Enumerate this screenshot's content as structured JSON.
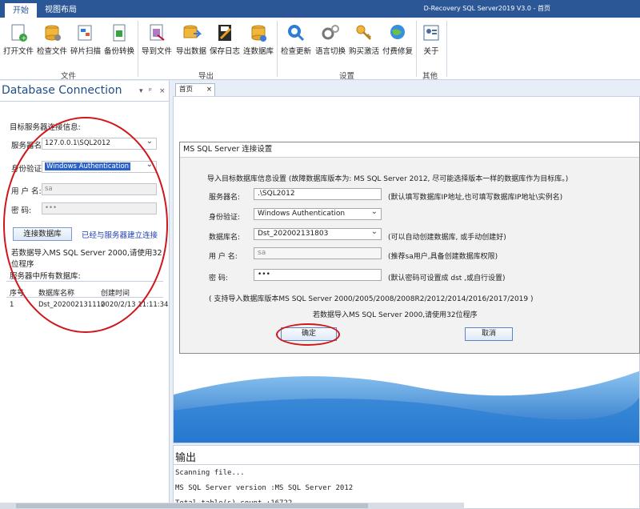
{
  "app": {
    "title": "D-Recovery SQL Server2019 V3.0 - 首页",
    "tabs": [
      "开始",
      "视图布局"
    ]
  },
  "ribbon": {
    "groups": [
      {
        "label": "文件",
        "buttons": [
          "打开文件",
          "检查文件",
          "碎片扫描",
          "备份转换"
        ]
      },
      {
        "label": "导出",
        "buttons": [
          "导到文件",
          "导出数据",
          "保存日志",
          "连数据库"
        ]
      },
      {
        "label": "设置",
        "buttons": [
          "检查更新",
          "语言切换",
          "购买激活",
          "付费修复"
        ]
      },
      {
        "label": "其他",
        "buttons": [
          "关于"
        ]
      }
    ]
  },
  "left_panel": {
    "title": "Database Connection",
    "controls": [
      "▾",
      "ᵖ",
      "×"
    ],
    "section_title": "目标服务器连接信息:",
    "server_label": "服务器名:",
    "server_value": "127.0.0.1\\SQL2012",
    "auth_label": "身份验证:",
    "auth_value": "Windows Authentication",
    "user_label": "用 户 名:",
    "user_value": "sa",
    "pwd_label": "密   码:",
    "pwd_value": "•••",
    "connect_button": "连接数据库",
    "connected_status": "已经与服务器建立连接",
    "note": "若数据导入MS SQL Server 2000,请使用32位程序",
    "db_section": "服务器中所有数据库:",
    "table": {
      "headers": [
        "序号",
        "数据库名称",
        "创建时间"
      ],
      "rows": [
        [
          "1",
          "Dst_202002131110",
          "2020/2/13 11:11:34"
        ]
      ]
    }
  },
  "doc": {
    "tab_label": "首页",
    "tab_close": "×"
  },
  "dialog": {
    "title": "MS SQL Server 连接设置",
    "intro": "导入目标数据库信息设置    (故障数据库版本为: MS SQL Server 2012, 尽可能选择版本一样的数据库作为目标库。)",
    "server_label": "服务器名:",
    "server_value": ".\\SQL2012",
    "server_hint": "(默认填写数据库IP地址,也可填写数据库IP地址\\实例名)",
    "auth_label": "身份验证:",
    "auth_value": "Windows Authentication",
    "db_label": "数据库名:",
    "db_value": "Dst_202002131803",
    "db_hint": "(可以自动创建数据库, 或手动创建好)",
    "user_label": "用 户 名:",
    "user_value": "sa",
    "user_hint": "(推荐sa用户,具备创建数据库权限)",
    "pwd_label": "密    码:",
    "pwd_value": "•••",
    "pwd_hint": "(默认密码可设置成 dst ,或自行设置)",
    "support": "( 支持导入数据库版本MS SQL Server 2000/2005/2008/2008R2/2012/2014/2016/2017/2019 )",
    "note": "若数据导入MS SQL Server 2000,请使用32位程序",
    "ok": "确定",
    "cancel": "取消"
  },
  "output": {
    "title": "输出",
    "lines": [
      "Scanning file...",
      "MS SQL Server version  :MS SQL Server 2012",
      "Total table(s) count   :16722"
    ]
  },
  "colors": {
    "titlebar": "#2b5797",
    "annotation": "#d0161b",
    "link": "#1f3fb0"
  }
}
